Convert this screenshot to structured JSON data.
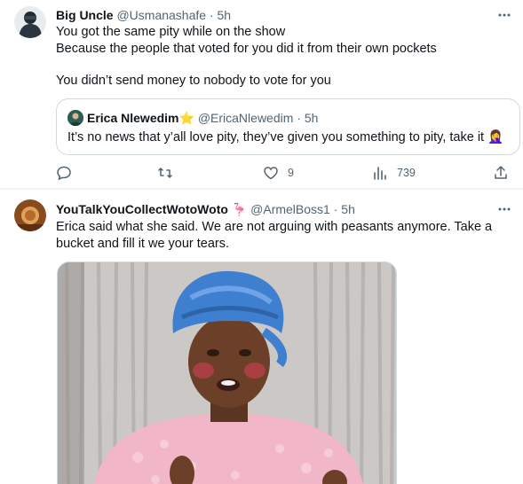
{
  "tweets": [
    {
      "author_name": "Big Uncle",
      "author_handle": "@Usmanashafe",
      "separator": "·",
      "time": "5h",
      "lines": [
        "You got the same pity while on the show",
        "Because the people that voted for you did it from their own pockets",
        "You didn’t send money to nobody to vote for you"
      ],
      "quote": {
        "author_name": "Erica Nlewedim",
        "name_emoji": "⭐",
        "author_handle": "@EricaNlewedim",
        "separator": "·",
        "time": "5h",
        "text": "It’s no news that y’all love pity, they’ve given you something to pity, take it",
        "text_emoji": "🤦‍♀️"
      },
      "actions": {
        "reply_count": "",
        "retweet_count": "",
        "like_count": "9",
        "views_count": "739"
      }
    },
    {
      "author_name": "YouTalkYouCollectWotoWoto",
      "name_emoji": "🦩",
      "author_handle": "@ArmelBoss1",
      "separator": "·",
      "time": "5h",
      "lines": [
        "Erica said what she said. We are not arguing with peasants anymore. Take a",
        "bucket and fill it we your tears."
      ],
      "media_description": "video still"
    }
  ],
  "icons": {
    "more": "more-dots-icon",
    "reply": "reply-icon",
    "retweet": "retweet-icon",
    "like": "heart-icon",
    "views": "views-chart-icon",
    "share": "share-icon"
  },
  "colors": {
    "text": "#0f1419",
    "secondary": "#536471",
    "border": "#cfd9de",
    "divider": "#eff3f4",
    "star": "#f4b400"
  }
}
